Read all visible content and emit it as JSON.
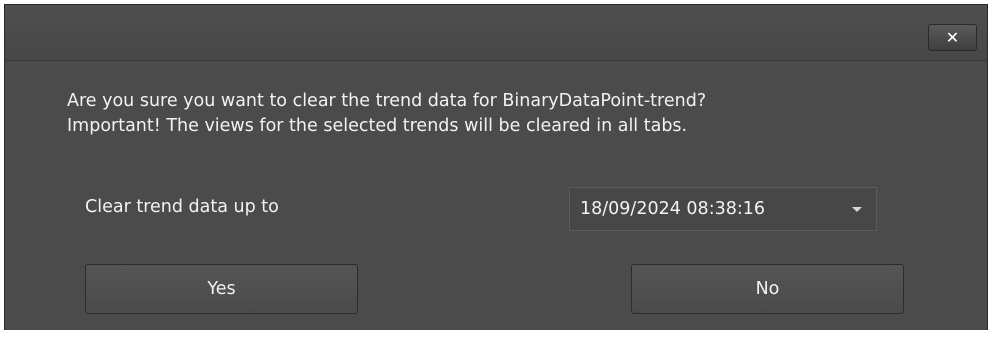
{
  "dialog": {
    "close_glyph": "✕",
    "message_line1": "Are you sure you want to clear the trend data for BinaryDataPoint-trend?",
    "message_line2": "Important! The views for the selected trends will be cleared in all tabs.",
    "clear_label": "Clear trend data up to",
    "date_value": "18/09/2024 08:38:16",
    "yes_label": "Yes",
    "no_label": "No"
  },
  "colors": {
    "background": "#4a4a4a",
    "text": "#f2f2f2"
  },
  "icons": {
    "close": "close-icon",
    "dropdown": "chevron-down-icon"
  }
}
